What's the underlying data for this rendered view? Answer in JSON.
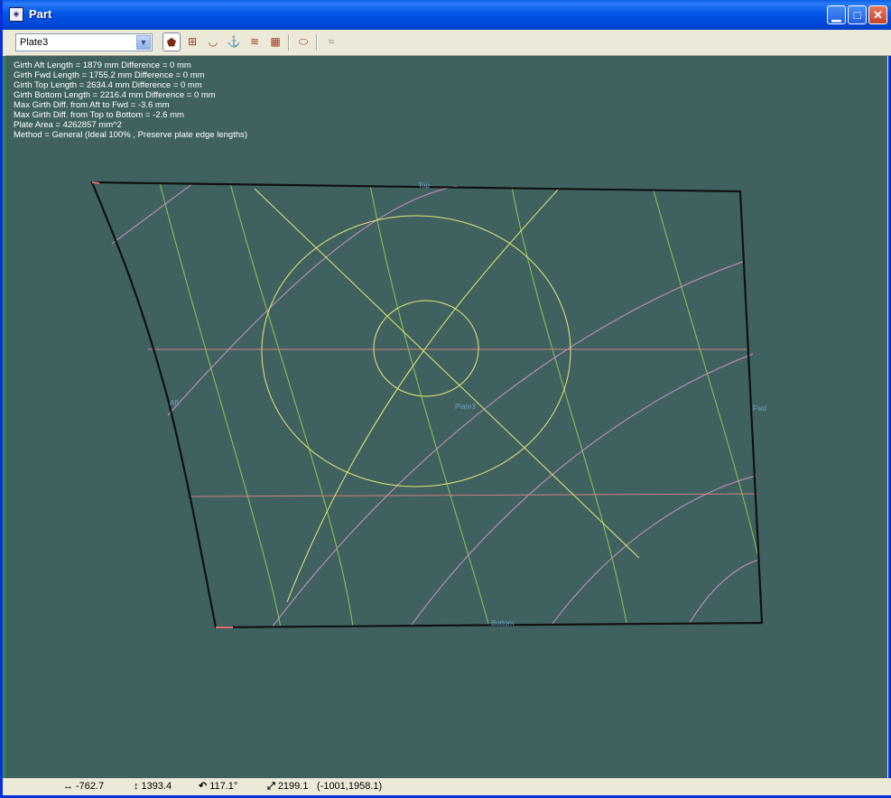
{
  "window": {
    "title": "Part",
    "minimize": "▁",
    "maximize": "□",
    "close": "✕"
  },
  "toolbar": {
    "plate_select": "Plate3",
    "tools": [
      "plate-view-icon",
      "grid-icon",
      "hull-shape-icon",
      "anchor-icon",
      "stack-icon",
      "lattice-icon",
      "profile-icon",
      "wave-icon"
    ]
  },
  "info": {
    "lines": [
      "Girth Aft Length = 1879 mm Difference = 0 mm",
      "Girth Fwd Length = 1755.2 mm Difference = 0 mm",
      "Girth Top Length = 2634.4 mm Difference = 0 mm",
      "Girth Bottom Length = 2216.4 mm Difference = 0 mm",
      "Max Girth Diff. from Aft to Fwd = -3.6 mm",
      "Max Girth Diff. from Top to Bottom = -2.6 mm",
      "Plate Area = 4262857 mm^2",
      "Method = General (Ideal 100% , Preserve plate edge lengths)"
    ]
  },
  "plate_labels": {
    "top": "Top",
    "aft": "Aft",
    "fwd": "Fwd",
    "center": "Plate3",
    "bottom": "Bottom"
  },
  "status": {
    "dx": "-762.7",
    "dy": "1393.4",
    "angle": "117.1°",
    "length": "2199.1",
    "coords": "(-1001,1958.1)"
  },
  "colors": {
    "canvas": "#3f6260",
    "outline": "#111111",
    "yellow": "#e8e870",
    "green": "#8cc850",
    "pink": "#d090c0",
    "red": "#d08080"
  }
}
